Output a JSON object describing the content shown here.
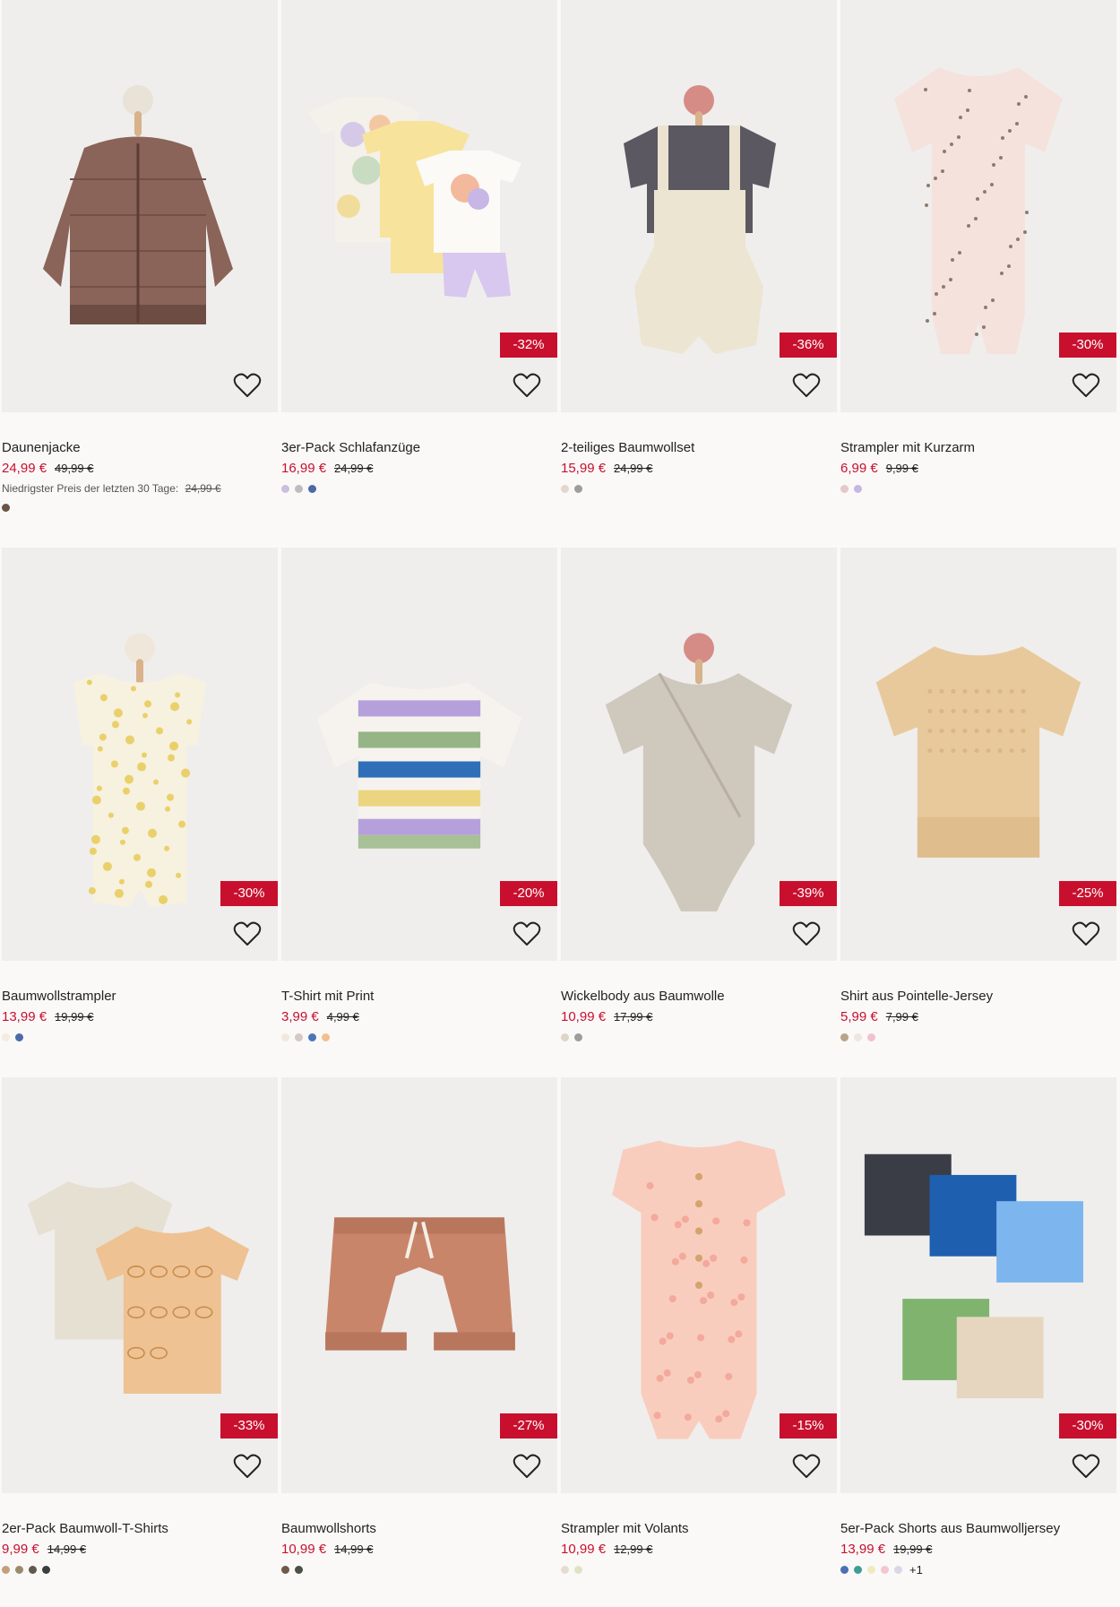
{
  "products": [
    {
      "name": "Daunenjacke",
      "price": "24,99 €",
      "old_price": "49,99 €",
      "discount": "",
      "lowest_label": "Niedrigster Preis der letzten 30 Tage:",
      "lowest_value": "24,99 €",
      "swatches": [
        "#6b5345"
      ],
      "more": "",
      "illustration": "jacket"
    },
    {
      "name": "3er-Pack Schlafanzüge",
      "price": "16,99 €",
      "old_price": "24,99 €",
      "discount": "-32%",
      "lowest_label": "",
      "lowest_value": "",
      "swatches": [
        "#c9bfdf",
        "#bdbdbd",
        "#4b6aa3"
      ],
      "more": "",
      "illustration": "pyjamas"
    },
    {
      "name": "2-teiliges Baumwollset",
      "price": "15,99 €",
      "old_price": "24,99 €",
      "discount": "-36%",
      "lowest_label": "",
      "lowest_value": "",
      "swatches": [
        "#e2d7cc",
        "#9d9d9d"
      ],
      "more": "",
      "illustration": "overall"
    },
    {
      "name": "Strampler mit Kurzarm",
      "price": "6,99 €",
      "old_price": "9,99 €",
      "discount": "-30%",
      "lowest_label": "",
      "lowest_value": "",
      "swatches": [
        "#e3c9c9",
        "#c4b7e3"
      ],
      "more": "",
      "illustration": "romper-pink"
    },
    {
      "name": "Baumwollstrampler",
      "price": "13,99 €",
      "old_price": "19,99 €",
      "discount": "-30%",
      "lowest_label": "",
      "lowest_value": "",
      "swatches": [
        "#f2eddc",
        "#4d6aa8"
      ],
      "more": "",
      "illustration": "romper-floral"
    },
    {
      "name": "T-Shirt mit Print",
      "price": "3,99 €",
      "old_price": "4,99 €",
      "discount": "-20%",
      "lowest_label": "",
      "lowest_value": "",
      "swatches": [
        "#efe9dd",
        "#d6c8c2",
        "#4a75b9",
        "#f1c08e"
      ],
      "more": "",
      "illustration": "striped-tee"
    },
    {
      "name": "Wickelbody aus Baumwolle",
      "price": "10,99 €",
      "old_price": "17,99 €",
      "discount": "-39%",
      "lowest_label": "",
      "lowest_value": "",
      "swatches": [
        "#ddd6c7",
        "#9d9d9d"
      ],
      "more": "",
      "illustration": "bodysuit"
    },
    {
      "name": "Shirt aus Pointelle-Jersey",
      "price": "5,99 €",
      "old_price": "7,99 €",
      "discount": "-25%",
      "lowest_label": "",
      "lowest_value": "",
      "swatches": [
        "#b6a58a",
        "#efe5e2",
        "#f0c2cc"
      ],
      "more": "",
      "illustration": "pointelle"
    },
    {
      "name": "2er-Pack Baumwoll-T-Shirts",
      "price": "9,99 €",
      "old_price": "14,99 €",
      "discount": "-33%",
      "lowest_label": "",
      "lowest_value": "",
      "swatches": [
        "#c2a07c",
        "#9c8a6c",
        "#5f5a4c",
        "#3d3d3d"
      ],
      "more": "",
      "illustration": "two-tees"
    },
    {
      "name": "Baumwollshorts",
      "price": "10,99 €",
      "old_price": "14,99 €",
      "discount": "-27%",
      "lowest_label": "",
      "lowest_value": "",
      "swatches": [
        "#6e5a48",
        "#4a5048"
      ],
      "more": "",
      "illustration": "shorts"
    },
    {
      "name": "Strampler mit Volants",
      "price": "10,99 €",
      "old_price": "12,99 €",
      "discount": "-15%",
      "lowest_label": "",
      "lowest_value": "",
      "swatches": [
        "#e6ddd0",
        "#dfe3c6"
      ],
      "more": "",
      "illustration": "romper-ruffle"
    },
    {
      "name": "5er-Pack Shorts aus Baumwolljersey",
      "price": "13,99 €",
      "old_price": "19,99 €",
      "discount": "-30%",
      "lowest_label": "",
      "lowest_value": "",
      "swatches": [
        "#4c6fb5",
        "#3e9c94",
        "#f1eabf",
        "#f2c6d1",
        "#ddd5e8"
      ],
      "more": "+1",
      "illustration": "five-shorts"
    }
  ],
  "icons": {
    "wishlist": "heart-outline-icon"
  },
  "colors": {
    "sale": "#c8102e",
    "text": "#222222",
    "background": "#faf9f8"
  }
}
